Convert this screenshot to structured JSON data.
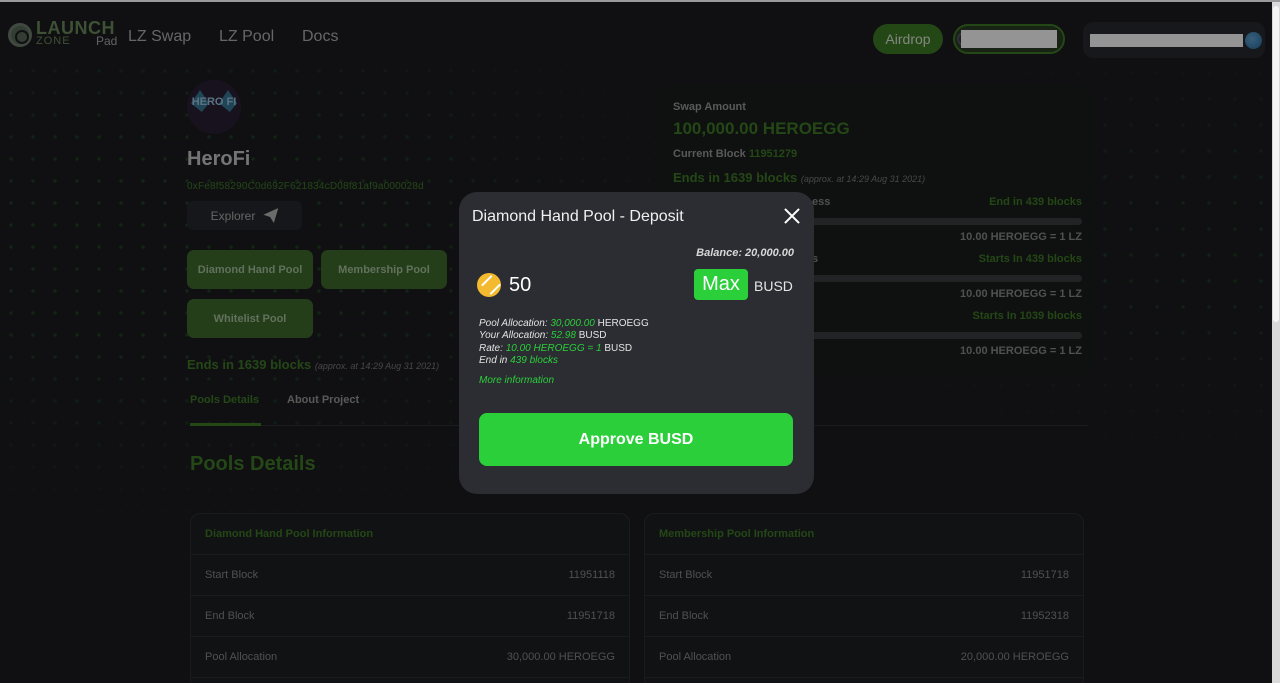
{
  "header": {
    "logo": {
      "launch": "LAUNCH",
      "zone": "ZONE",
      "pad": "Pad"
    },
    "nav": [
      "LZ Swap",
      "LZ Pool",
      "Docs"
    ],
    "airdrop_label": "Airdrop"
  },
  "project": {
    "name": "HeroFi",
    "avatar_text": "HERO FI",
    "address": "0xFe8f58290C0d692F621834cD08f81af9a000028d",
    "explorer_label": "Explorer",
    "pool_buttons": [
      "Diamond Hand Pool",
      "Membership Pool",
      "Whitelist Pool"
    ],
    "ends": "Ends in 1639 blocks",
    "ends_approx": "(approx. at 14:29 Aug 31 2021)",
    "tabs": [
      "Pools Details",
      "About Project"
    ],
    "pools_title": "Pools Details"
  },
  "tables": [
    {
      "title": "Diamond Hand Pool Information",
      "rows": [
        {
          "label": "Start Block",
          "value": "11951118"
        },
        {
          "label": "End Block",
          "value": "11951718"
        },
        {
          "label": "Pool Allocation",
          "value": "30,000.00 HEROEGG"
        }
      ]
    },
    {
      "title": "Membership Pool Information",
      "rows": [
        {
          "label": "Start Block",
          "value": "11951718"
        },
        {
          "label": "End Block",
          "value": "11952318"
        },
        {
          "label": "Pool Allocation",
          "value": "20,000.00 HEROEGG"
        }
      ]
    }
  ],
  "swap": {
    "label": "Swap Amount",
    "amount": "100,000.00 HEROEGG",
    "current_block_label": "Current Block",
    "current_block": "11951279",
    "ends": "Ends in 1639 blocks",
    "ends_approx": "(approx. at 14:29 Aug 31 2021)",
    "pools": [
      {
        "label_fragment": "ess",
        "status": "End in 439 blocks",
        "rate": "10.00 HEROEGG = 1 LZ"
      },
      {
        "label_fragment": "s",
        "status": "Starts In 439 blocks",
        "rate": "10.00 HEROEGG = 1 LZ"
      },
      {
        "label_fragment": "",
        "status": "Starts In 1039 blocks",
        "rate": "10.00 HEROEGG = 1 LZ"
      }
    ]
  },
  "modal": {
    "title": "Diamond Hand Pool - Deposit",
    "balance": "Balance: 20,000.00",
    "amount": "50",
    "max_label": "Max",
    "currency": "BUSD",
    "pool_allocation_label": "Pool Allocation:",
    "pool_allocation_value": "30,000.00",
    "pool_allocation_unit": "HEROEGG",
    "your_allocation_label": "Your Allocation:",
    "your_allocation_value": "52.98",
    "your_allocation_unit": "BUSD",
    "rate_label": "Rate:",
    "rate_value": "10.00 HEROEGG = 1",
    "rate_unit": "BUSD",
    "end_label": "End in",
    "end_value": "439 blocks",
    "more_info": "More information",
    "approve_label": "Approve",
    "approve_currency": "BUSD"
  },
  "colors": {
    "accent_dim": "#3f7a27",
    "accent_bright": "#2bcf3a",
    "modal_bg": "#2b2d32",
    "page_bg": "#1c1d22"
  }
}
